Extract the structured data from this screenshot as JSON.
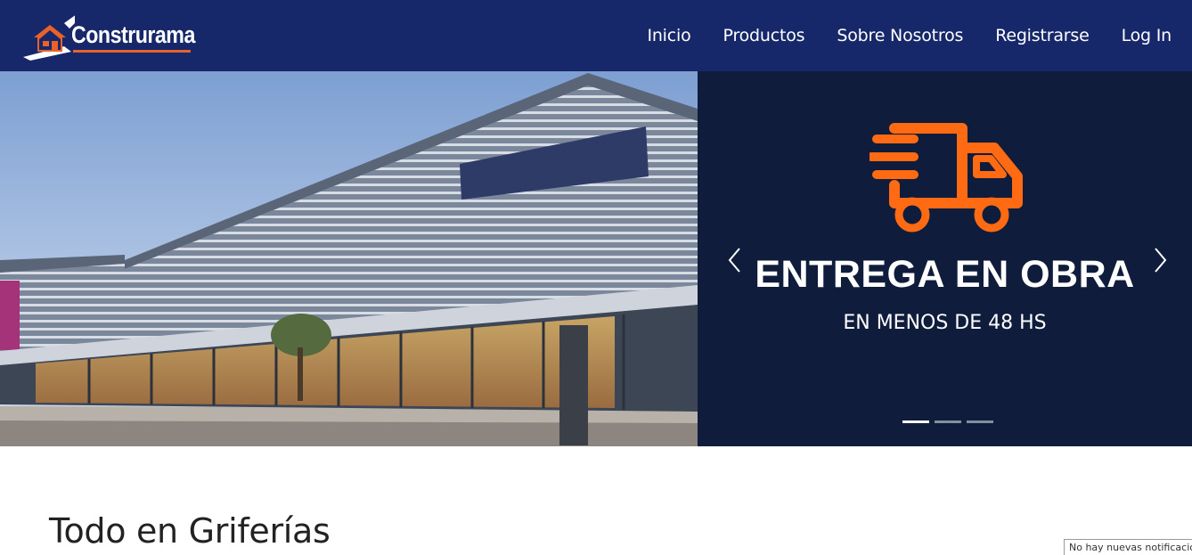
{
  "brand": {
    "name": "Construrama",
    "accent_color": "#e8622a",
    "nav_bg": "#16286a"
  },
  "nav": {
    "items": [
      {
        "label": "Inicio"
      },
      {
        "label": "Productos"
      },
      {
        "label": "Sobre Nosotros"
      },
      {
        "label": "Registrarse"
      },
      {
        "label": "Log In"
      }
    ]
  },
  "carousel": {
    "slide_title": "ENTREGA EN OBRA",
    "slide_subtitle": "EN MENOS DE 48 HS",
    "promo_icon": "delivery-truck-icon",
    "prev_icon": "chevron-left-icon",
    "next_icon": "chevron-right-icon",
    "slide_count": 3,
    "active_index": 0,
    "slide_bg": "#0f1c3b",
    "icon_color": "#ff6a13"
  },
  "section": {
    "title": "Todo en Griferías"
  },
  "notification": {
    "text": "No hay nuevas notificacio"
  }
}
